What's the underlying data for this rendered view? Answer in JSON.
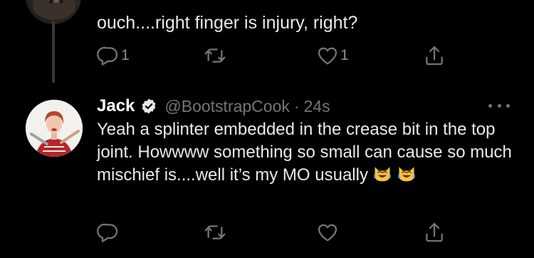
{
  "parent_tweet": {
    "text": "ouch....right finger is injury, right?",
    "reply_count": "1",
    "like_count": "1"
  },
  "reply_tweet": {
    "display_name": "Jack",
    "handle": "@BootstrapCook",
    "separator": "·",
    "time": "24s",
    "text": "Yeah a splinter embedded in the crease bit in the top joint. Howwww something so small can cause so much mischief is....well it’s my MO usually",
    "emoji": [
      "face-with-tears-of-joy-cat",
      "face-with-tears-of-joy-cat"
    ]
  },
  "icons": {
    "reply": "reply-icon",
    "retweet": "retweet-icon",
    "like": "heart-icon",
    "share": "share-icon",
    "verified": "verified-badge-icon",
    "more": "more-icon"
  },
  "colors": {
    "background": "#000000",
    "text": "#e7e9ea",
    "secondary": "#71767b",
    "thread_line": "#333a40"
  }
}
